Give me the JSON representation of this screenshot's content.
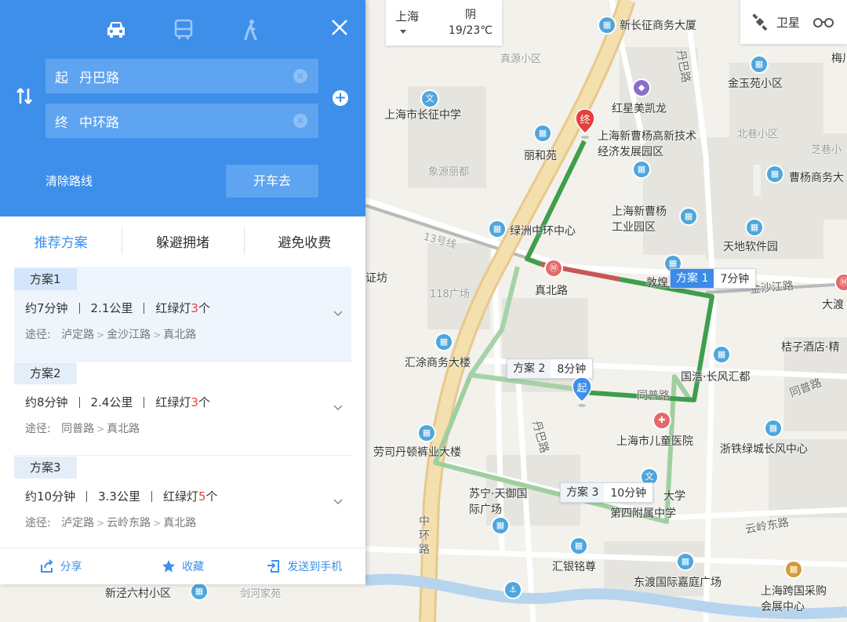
{
  "weather": {
    "city": "上海",
    "condition": "阴",
    "temp": "19/23℃"
  },
  "layers": {
    "satellite_label": "卫星"
  },
  "panel": {
    "modes": [
      {
        "name": "car-icon",
        "active": true
      },
      {
        "name": "bus-icon",
        "active": false
      },
      {
        "name": "walk-icon",
        "active": false
      }
    ],
    "start": {
      "prefix": "起",
      "value": "丹巴路"
    },
    "end": {
      "prefix": "终",
      "value": "中环路"
    },
    "clear_route": "清除路线",
    "go_button": "开车去",
    "tabs": [
      "推荐方案",
      "躲避拥堵",
      "避免收费"
    ],
    "plans": [
      {
        "name": "方案1",
        "time": "约7分钟",
        "distance": "2.1公里",
        "lights_prefix": "红绿灯",
        "lights": "3",
        "lights_suffix": "个",
        "via_label": "途径:",
        "via": [
          "泸定路",
          "金沙江路",
          "真北路"
        ]
      },
      {
        "name": "方案2",
        "time": "约8分钟",
        "distance": "2.4公里",
        "lights_prefix": "红绿灯",
        "lights": "3",
        "lights_suffix": "个",
        "via_label": "途径:",
        "via": [
          "同普路",
          "真北路"
        ]
      },
      {
        "name": "方案3",
        "time": "约10分钟",
        "distance": "3.3公里",
        "lights_prefix": "红绿灯",
        "lights": "5",
        "lights_suffix": "个",
        "via_label": "途径:",
        "via": [
          "泸定路",
          "云岭东路",
          "真北路"
        ]
      }
    ],
    "footer": {
      "share": "分享",
      "favorite": "收藏",
      "send": "发送到手机"
    }
  },
  "map": {
    "route_tags": [
      {
        "name": "方案 1",
        "time": "7分钟"
      },
      {
        "name": "方案 2",
        "time": "8分钟"
      },
      {
        "name": "方案 3",
        "time": "10分钟"
      }
    ],
    "markers": {
      "start": "起",
      "end": "终"
    },
    "labels": {
      "xinchangzheng": "新长征商务大厦",
      "zhenyuan": "真源小区",
      "danbalu_n": "丹巴路",
      "mei": "梅川",
      "jinyuyuan": "金玉苑小区",
      "hongxing": "红星美凯龙",
      "changzheng_school": "上海市长征中学",
      "caoyang_park": "上海新曹杨高新技术经济发展园区",
      "beixiang": "北巷小区",
      "zhicao": "芝巷小",
      "liheyuan": "丽和苑",
      "xiangyuan": "象源丽都",
      "caoyang_biz": "曹杨商务大",
      "caoyang_ind": "上海新曹杨工业园区",
      "lvzhou": "绿洲中环中心",
      "tiandi": "天地软件园",
      "line13": "13号线",
      "zhengfang": "证坊",
      "guangchang118": "118广场",
      "zhenbeilu_station": "真北路",
      "dunhuang": "敦煌",
      "jinshajiang": "金沙江路",
      "dadu": "大渡",
      "huitu": "汇涂商务大楼",
      "juzi": "桔子酒店·精",
      "guohao": "国浩·长风汇都",
      "tongpu": "同普路",
      "tongpu2": "同普路",
      "laosi": "劳司丹顿裤业大楼",
      "danbalu_s": "丹巴路",
      "childrens": "上海市儿童医院",
      "zhetie": "浙铁绿城长风中心",
      "suning": "苏宁·天御国际广场",
      "fushu": "附属中学",
      "fushu2": "第四附属中学",
      "daxue": "大学",
      "yunlingdong": "云岭东路",
      "zhonghuanlu": "中环路",
      "huiyin": "汇银铭尊",
      "dongdu": "东渡国际嘉庭广场",
      "kuajing": "上海跨国采购会展中心",
      "xinjing": "新泾六村小区",
      "jianhe": "剑河家苑"
    }
  }
}
